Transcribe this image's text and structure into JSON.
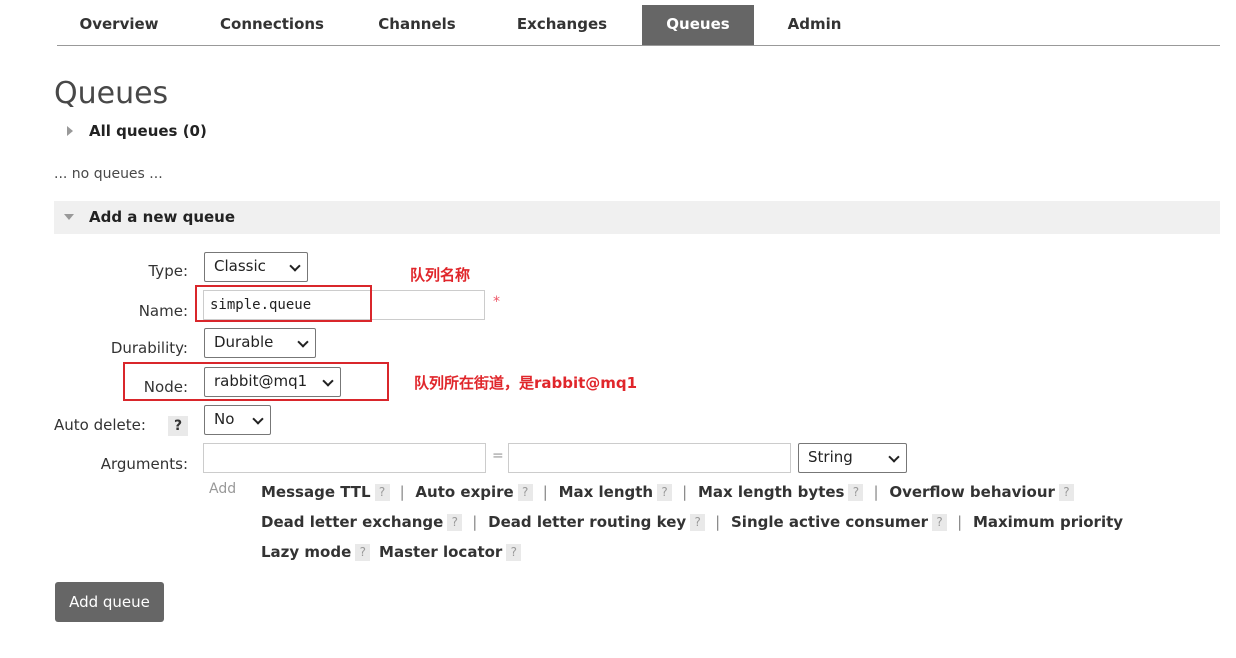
{
  "nav": {
    "tabs": [
      {
        "label": "Overview",
        "active": false
      },
      {
        "label": "Connections",
        "active": false
      },
      {
        "label": "Channels",
        "active": false
      },
      {
        "label": "Exchanges",
        "active": false
      },
      {
        "label": "Queues",
        "active": true
      },
      {
        "label": "Admin",
        "active": false
      }
    ]
  },
  "page": {
    "title": "Queues",
    "all_queues": "All queues (0)",
    "no_queues": "... no queues ...",
    "add_section": "Add a new queue"
  },
  "form": {
    "type_label": "Type:",
    "type_value": "Classic",
    "name_label": "Name:",
    "name_value": "simple.queue",
    "required_mark": "*",
    "durability_label": "Durability:",
    "durability_value": "Durable",
    "node_label": "Node:",
    "node_value": "rabbit@mq1",
    "auto_delete_label": "Auto delete:",
    "auto_delete_value": "No",
    "help_mark": "?",
    "arguments_label": "Arguments:",
    "equals": "=",
    "arg_type_value": "String",
    "add_label": "Add",
    "arg_shortcuts": [
      "Message TTL",
      "Auto expire",
      "Max length",
      "Max length bytes",
      "Overflow behaviour",
      "Dead letter exchange",
      "Dead letter routing key",
      "Single active consumer",
      "Maximum priority",
      "Lazy mode",
      "Master locator"
    ],
    "separator": "|"
  },
  "annotations": {
    "name_note": "队列名称",
    "node_note": "队列所在街道，是rabbit@mq1"
  },
  "buttons": {
    "add_queue": "Add queue"
  },
  "colors": {
    "accent": "#666666",
    "annotation_red": "#d9262b"
  }
}
